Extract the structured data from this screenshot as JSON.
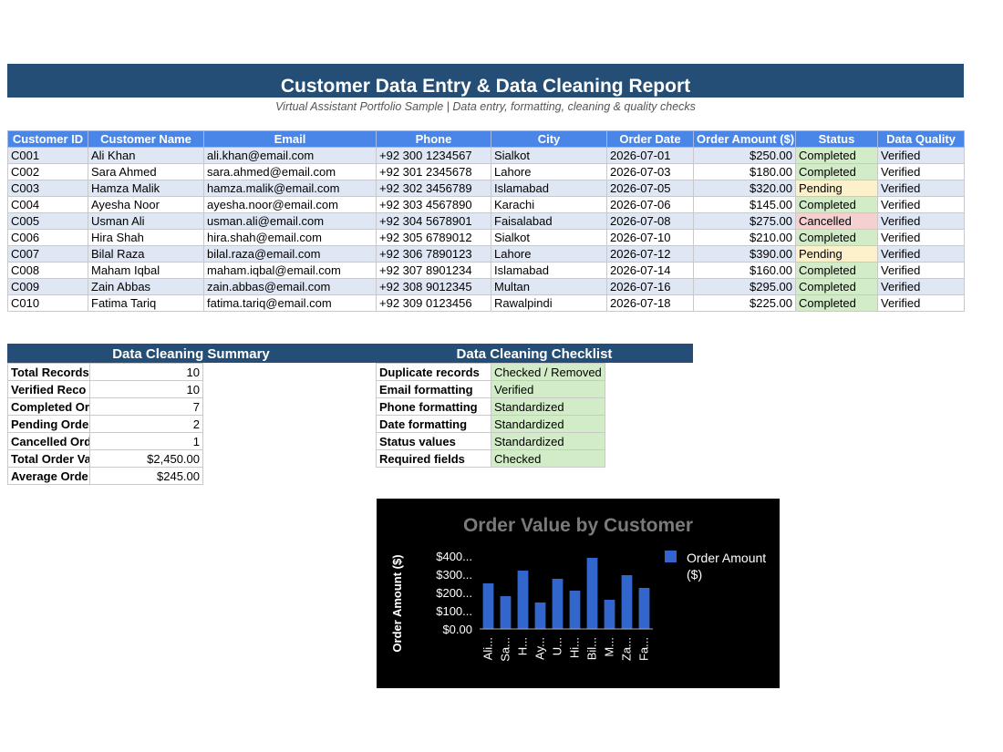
{
  "header": {
    "title": "Customer Data Entry & Data Cleaning Report",
    "subtitle": "Virtual Assistant Portfolio Sample | Data entry, formatting, cleaning & quality checks"
  },
  "table": {
    "columns": [
      "Customer ID",
      "Customer Name",
      "Email",
      "Phone",
      "City",
      "Order Date",
      "Order Amount ($)",
      "Status",
      "Data Quality"
    ],
    "rows": [
      [
        "C001",
        "Ali Khan",
        "ali.khan@email.com",
        "+92 300 1234567",
        "Sialkot",
        "2026-07-01",
        "$250.00",
        "Completed",
        "Verified"
      ],
      [
        "C002",
        "Sara Ahmed",
        "sara.ahmed@email.com",
        "+92 301 2345678",
        "Lahore",
        "2026-07-03",
        "$180.00",
        "Completed",
        "Verified"
      ],
      [
        "C003",
        "Hamza Malik",
        "hamza.malik@email.com",
        "+92 302 3456789",
        "Islamabad",
        "2026-07-05",
        "$320.00",
        "Pending",
        "Verified"
      ],
      [
        "C004",
        "Ayesha Noor",
        "ayesha.noor@email.com",
        "+92 303 4567890",
        "Karachi",
        "2026-07-06",
        "$145.00",
        "Completed",
        "Verified"
      ],
      [
        "C005",
        "Usman Ali",
        "usman.ali@email.com",
        "+92 304 5678901",
        "Faisalabad",
        "2026-07-08",
        "$275.00",
        "Cancelled",
        "Verified"
      ],
      [
        "C006",
        "Hira Shah",
        "hira.shah@email.com",
        "+92 305 6789012",
        "Sialkot",
        "2026-07-10",
        "$210.00",
        "Completed",
        "Verified"
      ],
      [
        "C007",
        "Bilal Raza",
        "bilal.raza@email.com",
        "+92 306 7890123",
        "Lahore",
        "2026-07-12",
        "$390.00",
        "Pending",
        "Verified"
      ],
      [
        "C008",
        "Maham Iqbal",
        "maham.iqbal@email.com",
        "+92 307 8901234",
        "Islamabad",
        "2026-07-14",
        "$160.00",
        "Completed",
        "Verified"
      ],
      [
        "C009",
        "Zain Abbas",
        "zain.abbas@email.com",
        "+92 308 9012345",
        "Multan",
        "2026-07-16",
        "$295.00",
        "Completed",
        "Verified"
      ],
      [
        "C010",
        "Fatima Tariq",
        "fatima.tariq@email.com",
        "+92 309 0123456",
        "Rawalpindi",
        "2026-07-18",
        "$225.00",
        "Completed",
        "Verified"
      ]
    ]
  },
  "summary": {
    "title": "Data Cleaning Summary",
    "rows": [
      {
        "label": "Total Records",
        "value": "10"
      },
      {
        "label": "Verified Reco",
        "value": "10"
      },
      {
        "label": "Completed Or",
        "value": "7"
      },
      {
        "label": "Pending Orde",
        "value": "2"
      },
      {
        "label": "Cancelled Ord",
        "value": "1"
      },
      {
        "label": "Total Order Va",
        "value": "$2,450.00"
      },
      {
        "label": "Average Orde",
        "value": "$245.00"
      }
    ]
  },
  "checklist": {
    "title": "Data Cleaning Checklist",
    "rows": [
      {
        "label": "Duplicate records",
        "value": "Checked / Removed"
      },
      {
        "label": "Email formatting",
        "value": "Verified"
      },
      {
        "label": "Phone formatting",
        "value": "Standardized"
      },
      {
        "label": "Date formatting",
        "value": "Standardized"
      },
      {
        "label": "Status values",
        "value": "Standardized"
      },
      {
        "label": "Required fields",
        "value": "Checked"
      }
    ]
  },
  "colors": {
    "header_bar": "#244e75",
    "table_header": "#4a86e8",
    "row_alt": "#dfe6f4",
    "completed": "#d2ecc8",
    "pending": "#fdf1cc",
    "cancelled": "#f6cfd1",
    "bar": "#3366cc"
  },
  "chart_data": {
    "type": "bar",
    "title": "Order Value by Customer",
    "ylabel": "Order Amount ($)",
    "xlabel": "",
    "categories": [
      "Ali...",
      "Sa...",
      "H...",
      "Ay...",
      "U...",
      "Hi...",
      "Bil...",
      "M...",
      "Za...",
      "Fa..."
    ],
    "series": [
      {
        "name": "Order Amount ($)",
        "values": [
          250,
          180,
          320,
          145,
          275,
          210,
          390,
          160,
          295,
          225
        ]
      }
    ],
    "yticks": [
      "$0.00",
      "$100...",
      "$200...",
      "$300...",
      "$400..."
    ],
    "ytick_values": [
      0,
      100,
      200,
      300,
      400
    ],
    "ylim": [
      0,
      400
    ],
    "legend_lines": [
      "Order Amount",
      "($)"
    ],
    "legend_position": "right",
    "grid": false
  }
}
